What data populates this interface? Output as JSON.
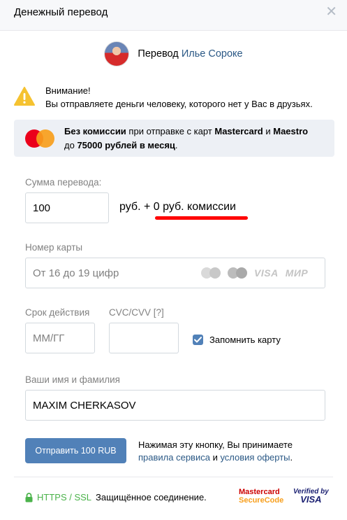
{
  "header": {
    "title": "Денежный перевод",
    "close_glyph": "✕"
  },
  "recipient": {
    "prefix": "Перевод",
    "name": "Илье Сороке"
  },
  "warning": {
    "title": "Внимание!",
    "text": "Вы отправляете деньги человеку, которого нет у Вас в друзьях."
  },
  "promo": {
    "l1_bold": "Без комиссии",
    "l1_mid": " при отправке с карт ",
    "l1_mc": "Mastercard",
    "l1_and": " и ",
    "l1_maestro": "Maestro",
    "l2_pre": "до ",
    "l2_bold": "75000 рублей в месяц",
    "l2_end": "."
  },
  "amount": {
    "label": "Сумма перевода:",
    "value": "100",
    "commission_prefix": "руб. + ",
    "commission_text": "0 руб. комиссии"
  },
  "card": {
    "label": "Номер карты",
    "placeholder": "От 16 до 19 цифр",
    "visa": "VISA",
    "mir": "МИР"
  },
  "expiry": {
    "label": "Срок действия",
    "placeholder": "ММ/ГГ"
  },
  "cvc": {
    "label": "CVC/CVV [?]",
    "value": ""
  },
  "remember": {
    "label": "Запомнить карту",
    "checked": true
  },
  "name": {
    "label": "Ваши имя и фамилия",
    "value": "MAXIM CHERKASOV"
  },
  "submit": {
    "label": "Отправить 100 RUB"
  },
  "terms": {
    "line1": "Нажимая эту кнопку, Вы принимаете",
    "link1": "правила сервиса",
    "and": " и ",
    "link2": "условия оферты",
    "end": "."
  },
  "footer": {
    "https": "HTTPS / SSL",
    "secure_text": " Защищённое соединение.",
    "mc_line1": "Mastercard",
    "mc_line2": "SecureCode",
    "vbv_line1": "Verified by",
    "vbv_line2": "VISA"
  },
  "colors": {
    "accent": "#5181b8",
    "link": "#2a5885",
    "highlight": "#ff0000",
    "secure": "#4bb34b"
  }
}
